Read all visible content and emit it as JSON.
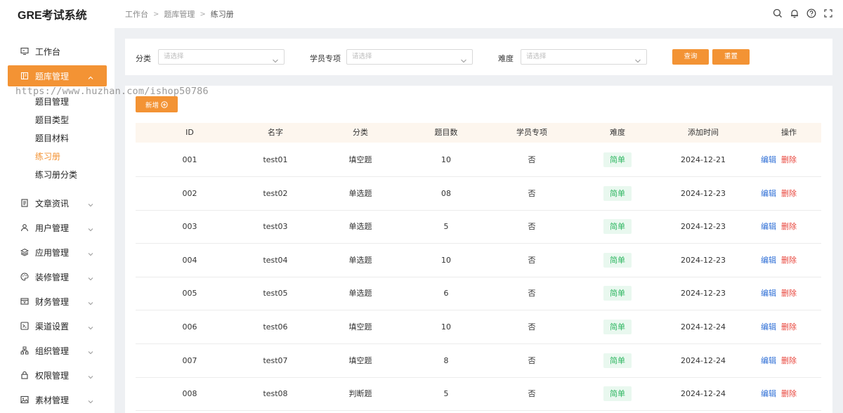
{
  "app": {
    "title": "GRE考试系统"
  },
  "breadcrumb": [
    "工作台",
    "题库管理",
    "练习册"
  ],
  "header_icons": [
    "search-icon",
    "bell-icon",
    "help-icon",
    "fullscreen-icon"
  ],
  "sidebar": {
    "items": [
      {
        "label": "工作台",
        "icon": "monitor-icon"
      },
      {
        "label": "题库管理",
        "icon": "book-icon",
        "active": true,
        "expanded": true
      },
      {
        "label": "文章资讯",
        "icon": "document-icon"
      },
      {
        "label": "用户管理",
        "icon": "user-icon"
      },
      {
        "label": "应用管理",
        "icon": "layers-icon"
      },
      {
        "label": "装修管理",
        "icon": "palette-icon"
      },
      {
        "label": "财务管理",
        "icon": "wallet-icon"
      },
      {
        "label": "渠道设置",
        "icon": "channel-icon"
      },
      {
        "label": "组织管理",
        "icon": "org-icon"
      },
      {
        "label": "权限管理",
        "icon": "lock-icon"
      },
      {
        "label": "素材管理",
        "icon": "image-icon"
      }
    ],
    "subitems": [
      {
        "label": "题目管理"
      },
      {
        "label": "题目类型"
      },
      {
        "label": "题目材料"
      },
      {
        "label": "练习册",
        "active": true
      },
      {
        "label": "练习册分类"
      }
    ]
  },
  "watermark": "https://www.huzhan.com/ishop50786",
  "filters": {
    "category": {
      "label": "分类",
      "placeholder": "请选择"
    },
    "special": {
      "label": "学员专项",
      "placeholder": "请选择"
    },
    "difficulty": {
      "label": "难度",
      "placeholder": "请选择"
    },
    "query_label": "查询",
    "reset_label": "重置"
  },
  "add_button": {
    "label": "新增"
  },
  "table": {
    "columns": [
      "ID",
      "名字",
      "分类",
      "题目数",
      "学员专项",
      "难度",
      "添加时间",
      "操作"
    ],
    "rows": [
      {
        "id": "001",
        "name": "test01",
        "category": "填空题",
        "count": "10",
        "special": "否",
        "difficulty": "简单",
        "date": "2024-12-21",
        "edit": "编辑",
        "delete": "删除"
      },
      {
        "id": "002",
        "name": "test02",
        "category": "单选题",
        "count": "08",
        "special": "否",
        "difficulty": "简单",
        "date": "2024-12-23",
        "edit": "编辑",
        "delete": "删除"
      },
      {
        "id": "003",
        "name": "test03",
        "category": "单选题",
        "count": "5",
        "special": "否",
        "difficulty": "简单",
        "date": "2024-12-23",
        "edit": "编辑",
        "delete": "删除"
      },
      {
        "id": "004",
        "name": "test04",
        "category": "单选题",
        "count": "10",
        "special": "否",
        "difficulty": "简单",
        "date": "2024-12-23",
        "edit": "编辑",
        "delete": "删除"
      },
      {
        "id": "005",
        "name": "test05",
        "category": "单选题",
        "count": "6",
        "special": "否",
        "difficulty": "简单",
        "date": "2024-12-23",
        "edit": "编辑",
        "delete": "删除"
      },
      {
        "id": "006",
        "name": "test06",
        "category": "填空题",
        "count": "10",
        "special": "否",
        "difficulty": "简单",
        "date": "2024-12-24",
        "edit": "编辑",
        "delete": "删除"
      },
      {
        "id": "007",
        "name": "test07",
        "category": "填空题",
        "count": "8",
        "special": "否",
        "difficulty": "简单",
        "date": "2024-12-24",
        "edit": "编辑",
        "delete": "删除"
      },
      {
        "id": "008",
        "name": "test08",
        "category": "判断题",
        "count": "5",
        "special": "否",
        "difficulty": "简单",
        "date": "2024-12-24",
        "edit": "编辑",
        "delete": "删除"
      }
    ]
  },
  "colors": {
    "accent": "#f39334",
    "edit": "#2f6fd6",
    "delete": "#e8453c",
    "badge_text": "#2db660",
    "badge_bg": "#e9f8ef"
  }
}
